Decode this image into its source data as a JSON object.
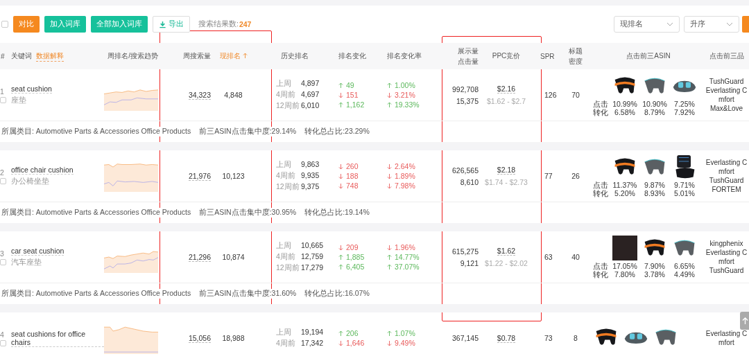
{
  "toolbar": {
    "select_all_checked": false,
    "buttons": [
      {
        "label": "对比",
        "kind": "primary"
      },
      {
        "label": "加入词库",
        "kind": "accent"
      },
      {
        "label": "全部加入词库",
        "kind": "accent"
      },
      {
        "label": "导出",
        "kind": "outline"
      }
    ],
    "result_label": "搜索结果数:",
    "result_count": "247",
    "sort_selects": [
      {
        "value": "现排名"
      },
      {
        "value": "升序"
      }
    ]
  },
  "table": {
    "columns": [
      {
        "label": "#",
        "sorted": false
      },
      {
        "label": "关键词",
        "help_link": "数据解释",
        "sorted": false
      },
      {
        "label": "周排名/搜索趋势",
        "sorted": false
      },
      {
        "label": "周搜索量",
        "sorted": false
      },
      {
        "label": "现排名",
        "sorted": true
      },
      {
        "label": "历史排名",
        "sorted": false
      },
      {
        "label": "排名变化",
        "sorted": false
      },
      {
        "label": "排名变化率",
        "sorted": false
      },
      {
        "label": "展示量",
        "sublabel": "点击量",
        "sorted": false
      },
      {
        "label": "PPC竞价",
        "sorted": false
      },
      {
        "label": "SPR",
        "sorted": false
      },
      {
        "label": "标题",
        "sublabel": "密度",
        "sorted": false
      },
      {
        "label": "点击前三ASIN",
        "sorted": false
      },
      {
        "label": "点击前三品",
        "sorted": false
      }
    ],
    "rows": [
      {
        "index": "1",
        "keyword": "seat cushion",
        "translation": "座垫",
        "checked": false,
        "weekly_search": "34,323",
        "current_rank": "4,848",
        "history": [
          {
            "period": "上周",
            "rank": "4,897",
            "rising": true,
            "change": "49",
            "rate": "1.00%"
          },
          {
            "period": "4周前",
            "rank": "4,697",
            "rising": false,
            "change": "151",
            "rate": "3.21%"
          },
          {
            "period": "12周前",
            "rank": "6,010",
            "rising": true,
            "change": "1,162",
            "rate": "19.33%"
          }
        ],
        "impressions": "992,708",
        "clicks": "15,375",
        "ppc": "$2.16",
        "ppc_range": "$1.62 - $2.7",
        "spr": "126",
        "title_density": "70",
        "click_label": "点击",
        "conversion_label": "转化",
        "asins": [
          {
            "kind": "orange-band",
            "click": "10.99%",
            "conversion": "6.58%"
          },
          {
            "kind": "grey",
            "click": "10.90%",
            "conversion": "8.79%"
          },
          {
            "kind": "gel",
            "click": "7.25%",
            "conversion": "7.92%"
          }
        ],
        "brands": [
          "TushGuard",
          "Everlasting C",
          "mfort",
          "Max&Love"
        ],
        "category": "所属类目: Automotive Parts & Accessories Office Products",
        "concentration": "前三ASIN点击集中度:29.14%",
        "conversion_share": "转化总占比:23.29%"
      },
      {
        "index": "2",
        "keyword": "office chair cushion",
        "translation": "办公椅坐垫",
        "checked": false,
        "weekly_search": "21,976",
        "current_rank": "10,123",
        "history": [
          {
            "period": "上周",
            "rank": "9,863",
            "rising": false,
            "change": "260",
            "rate": "2.64%"
          },
          {
            "period": "4周前",
            "rank": "9,935",
            "rising": false,
            "change": "188",
            "rate": "1.89%"
          },
          {
            "period": "12周前",
            "rank": "9,375",
            "rising": false,
            "change": "748",
            "rate": "7.98%"
          }
        ],
        "impressions": "626,565",
        "clicks": "8,610",
        "ppc": "$2.18",
        "ppc_range": "$1.74 - $2.73",
        "spr": "77",
        "title_density": "26",
        "click_label": "点击",
        "conversion_label": "转化",
        "asins": [
          {
            "kind": "orange-band",
            "click": "11.37%",
            "conversion": "5.20%"
          },
          {
            "kind": "grey",
            "click": "9.87%",
            "conversion": "8.93%"
          },
          {
            "kind": "backrest",
            "click": "9.71%",
            "conversion": "5.01%"
          }
        ],
        "brands": [
          "Everlasting C",
          "mfort",
          "TushGuard",
          "FORTEM"
        ],
        "category": "所属类目: Automotive Parts & Accessories Office Products",
        "concentration": "前三ASIN点击集中度:30.95%",
        "conversion_share": "转化总占比:19.14%"
      },
      {
        "index": "3",
        "keyword": "car seat cushion",
        "translation": "汽车座垫",
        "checked": false,
        "weekly_search": "21,296",
        "current_rank": "10,874",
        "history": [
          {
            "period": "上周",
            "rank": "10,665",
            "rising": false,
            "change": "209",
            "rate": "1.96%"
          },
          {
            "period": "4周前",
            "rank": "12,759",
            "rising": true,
            "change": "1,885",
            "rate": "14.77%"
          },
          {
            "period": "12周前",
            "rank": "17,279",
            "rising": true,
            "change": "6,405",
            "rate": "37.07%"
          }
        ],
        "impressions": "615,275",
        "clicks": "9,121",
        "ppc": "$1.62",
        "ppc_range": "$1.22 - $2.02",
        "spr": "63",
        "title_density": "40",
        "click_label": "点击",
        "conversion_label": "转化",
        "asins": [
          {
            "kind": "photo",
            "click": "17.05%",
            "conversion": "7.80%"
          },
          {
            "kind": "orange-band",
            "click": "7.90%",
            "conversion": "3.78%"
          },
          {
            "kind": "grey",
            "click": "6.65%",
            "conversion": "4.49%"
          }
        ],
        "brands": [
          "kingphenix",
          "Everlasting C",
          "mfort",
          "TushGuard"
        ],
        "category": "所属类目: Automotive Parts & Accessories Office Products",
        "concentration": "前三ASIN点击集中度:31.60%",
        "conversion_share": "转化总占比:16.07%"
      },
      {
        "index": "4",
        "keyword": "seat cushions for office chairs",
        "checked": false,
        "weekly_search": "15,056",
        "current_rank": "18,988",
        "history": [
          {
            "period": "上周",
            "rank": "19,194",
            "rising": true,
            "change": "206",
            "rate": "1.07%"
          },
          {
            "period": "4周前",
            "rank": "17,342",
            "rising": false,
            "change": "1,646",
            "rate": "9.49%"
          }
        ],
        "impressions": "367,145",
        "ppc": "$0.78",
        "spr": "73",
        "title_density": "8",
        "asins": [
          {
            "kind": "orange-band"
          },
          {
            "kind": "gel"
          },
          {
            "kind": "grey"
          }
        ],
        "brands": [
          "Everlasting C",
          "mfort"
        ]
      }
    ]
  }
}
